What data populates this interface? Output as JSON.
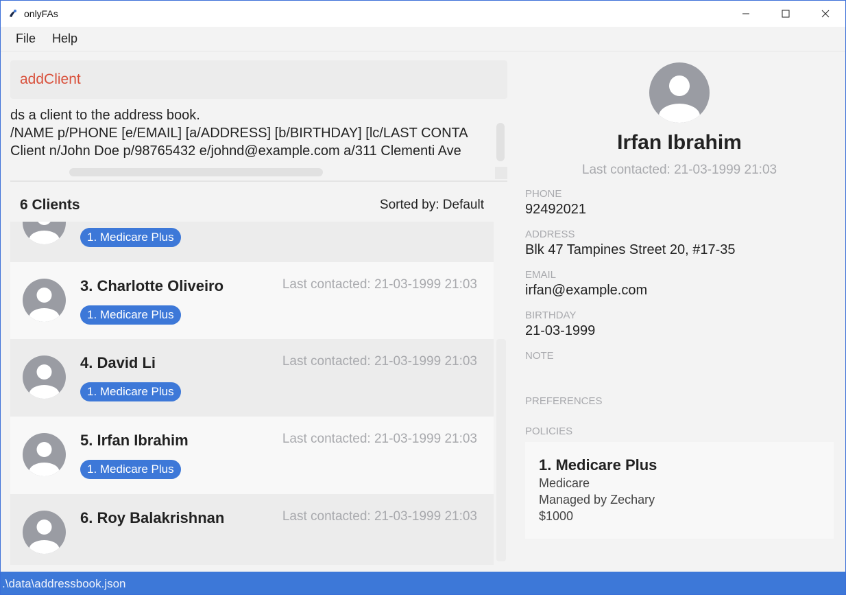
{
  "window": {
    "title": "onlyFAs"
  },
  "menu": {
    "file": "File",
    "help": "Help"
  },
  "command": {
    "text": "addClient"
  },
  "result": {
    "lines": [
      "ds a client to the address book.",
      "/NAME p/PHONE [e/EMAIL] [a/ADDRESS] [b/BIRTHDAY] [lc/LAST CONTA",
      "Client n/John Doe p/98765432 e/johnd@example.com a/311 Clementi Ave"
    ]
  },
  "list": {
    "count_label": "6 Clients",
    "sorted_label": "Sorted by: Default",
    "clients": [
      {
        "name": "",
        "last_contacted": "",
        "policy": "1. Medicare Plus"
      },
      {
        "name": "3.  Charlotte Oliveiro",
        "last_contacted": "Last contacted: 21-03-1999 21:03",
        "policy": "1. Medicare Plus"
      },
      {
        "name": "4.  David Li",
        "last_contacted": "Last contacted: 21-03-1999 21:03",
        "policy": "1. Medicare Plus"
      },
      {
        "name": "5.  Irfan Ibrahim",
        "last_contacted": "Last contacted: 21-03-1999 21:03",
        "policy": "1. Medicare Plus"
      },
      {
        "name": "6.  Roy Balakrishnan",
        "last_contacted": "Last contacted: 21-03-1999 21:03",
        "policy": ""
      }
    ]
  },
  "detail": {
    "name": "Irfan Ibrahim",
    "last_contacted": "Last contacted: 21-03-1999 21:03",
    "phone_label": "PHONE",
    "phone": "92492021",
    "address_label": "ADDRESS",
    "address": "Blk 47 Tampines Street 20, #17-35",
    "email_label": "EMAIL",
    "email": "irfan@example.com",
    "birthday_label": "BIRTHDAY",
    "birthday": "21-03-1999",
    "note_label": "NOTE",
    "preferences_label": "PREFERENCES",
    "policies_label": "POLICIES",
    "policy": {
      "title": "1.  Medicare Plus",
      "type": "Medicare",
      "manager": "Managed by Zechary",
      "amount": "$1000"
    }
  },
  "status": {
    "path": ".\\data\\addressbook.json"
  },
  "colors": {
    "accent": "#3d78d8",
    "command": "#d9513c",
    "muted": "#a8a9ad"
  }
}
